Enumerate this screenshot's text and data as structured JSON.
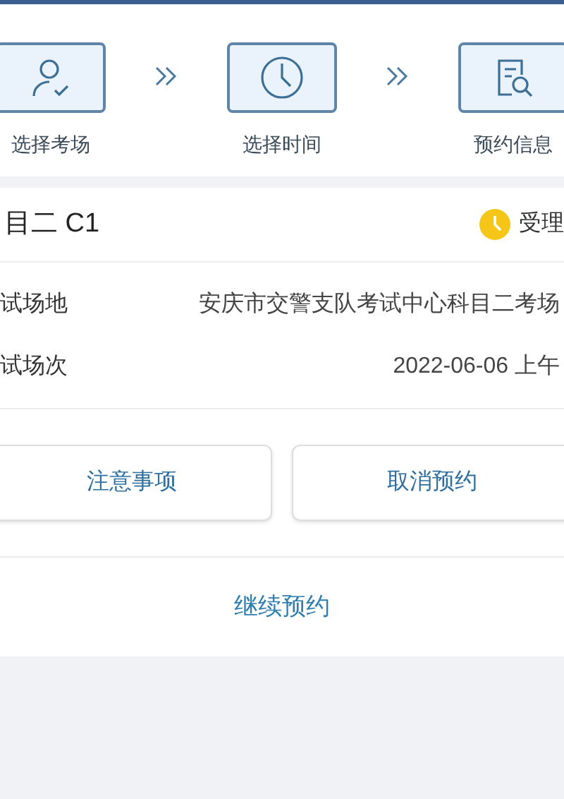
{
  "steps": [
    {
      "label": "选择考场",
      "kind": "person"
    },
    {
      "label": "选择时间",
      "kind": "clock"
    },
    {
      "label": "预约信息",
      "kind": "document"
    }
  ],
  "card": {
    "title": "目二 C1",
    "status": "受理",
    "rows": [
      {
        "label": "试场地",
        "value": "安庆市交警支队考试中心科目二考场"
      },
      {
        "label": "试场次",
        "value": "2022-06-06 上午"
      }
    ],
    "buttons": [
      "注意事项",
      "取消预约"
    ],
    "footer_button": "继续预约"
  }
}
